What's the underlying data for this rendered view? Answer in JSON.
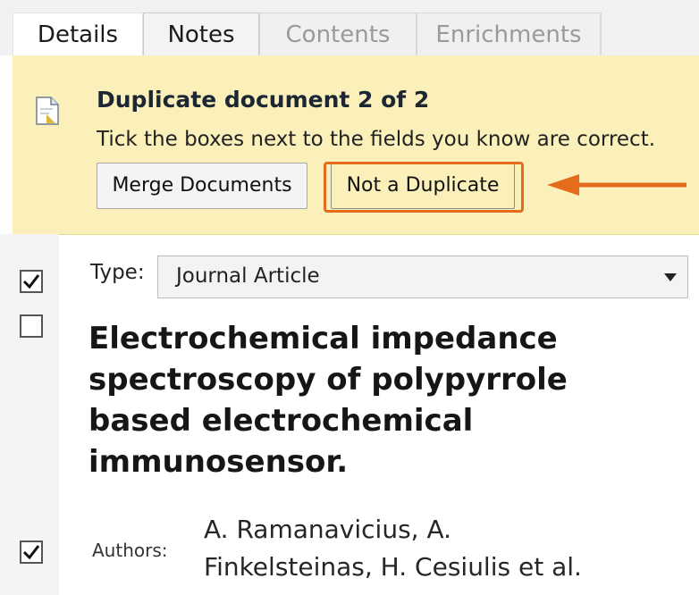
{
  "tabs": [
    {
      "label": "Details",
      "state": "active"
    },
    {
      "label": "Notes",
      "state": "normal"
    },
    {
      "label": "Contents",
      "state": "disabled"
    },
    {
      "label": "Enrichments",
      "state": "disabled"
    }
  ],
  "duplicate_banner": {
    "icon": "document-icon",
    "title": "Duplicate document 2 of 2",
    "hint": "Tick the boxes next to the fields you know are correct.",
    "merge_button": "Merge Documents",
    "not_duplicate_button": "Not a Duplicate",
    "highlight_color": "#e46c1c",
    "background_color": "#fbf0b9"
  },
  "fields": {
    "type": {
      "label": "Type:",
      "value": "Journal Article",
      "checked": true
    },
    "title": {
      "checked": false,
      "lines": [
        "Electrochemical impedance",
        "spectroscopy of polypyrrole",
        "based electrochemical",
        "immunosensor."
      ]
    },
    "authors": {
      "label": "Authors:",
      "checked": true,
      "lines": [
        "A. Ramanavicius, A.",
        "Finkelsteinas, H. Cesiulis et al."
      ]
    }
  }
}
